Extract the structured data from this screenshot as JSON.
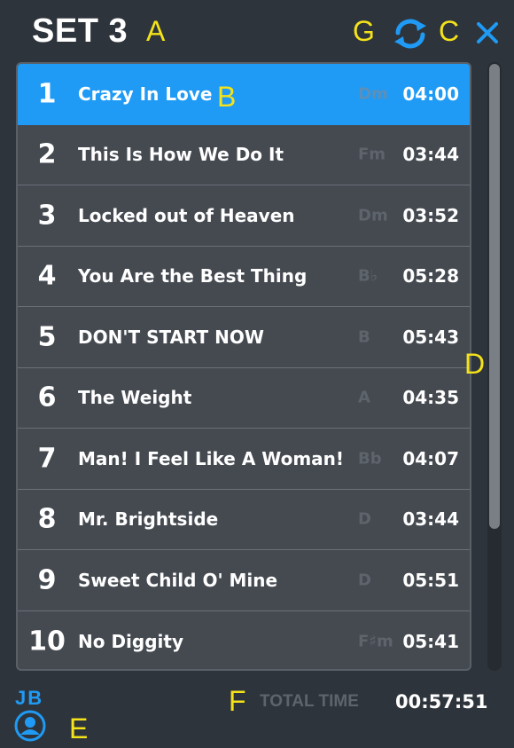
{
  "header": {
    "title": "SET 3"
  },
  "annotations": {
    "A": "A",
    "B": "B",
    "C": "C",
    "D": "D",
    "E": "E",
    "F": "F",
    "G": "G"
  },
  "icons": {
    "refresh": "refresh-icon",
    "close": "close-icon",
    "user": "user-icon"
  },
  "colors": {
    "accent": "#1f9bf5",
    "background": "#2e343c",
    "panel": "#454a51",
    "annotation": "#f4e21a"
  },
  "songs": [
    {
      "num": "1",
      "title": "Crazy In Love",
      "key": "Dm",
      "duration": "04:00",
      "selected": true
    },
    {
      "num": "2",
      "title": "This Is How We Do It",
      "key": "Fm",
      "duration": "03:44"
    },
    {
      "num": "3",
      "title": "Locked out of Heaven",
      "key": "Dm",
      "duration": "03:52"
    },
    {
      "num": "4",
      "title": "You Are the Best Thing",
      "key": "B♭",
      "duration": "05:28"
    },
    {
      "num": "5",
      "title": "DON'T START NOW",
      "key": "B",
      "duration": "05:43"
    },
    {
      "num": "6",
      "title": "The Weight",
      "key": "A",
      "duration": "04:35"
    },
    {
      "num": "7",
      "title": "Man! I Feel Like A Woman!",
      "key": "Bb",
      "duration": "04:07"
    },
    {
      "num": "8",
      "title": "Mr. Brightside",
      "key": "D",
      "duration": "03:44"
    },
    {
      "num": "9",
      "title": "Sweet Child O' Mine",
      "key": "D",
      "duration": "05:51"
    },
    {
      "num": "10",
      "title": "No Diggity",
      "key": "F♯m",
      "duration": "05:41"
    }
  ],
  "footer": {
    "user_initials": "JB",
    "total_label": "TOTAL TIME",
    "total_time": "00:57:51"
  }
}
